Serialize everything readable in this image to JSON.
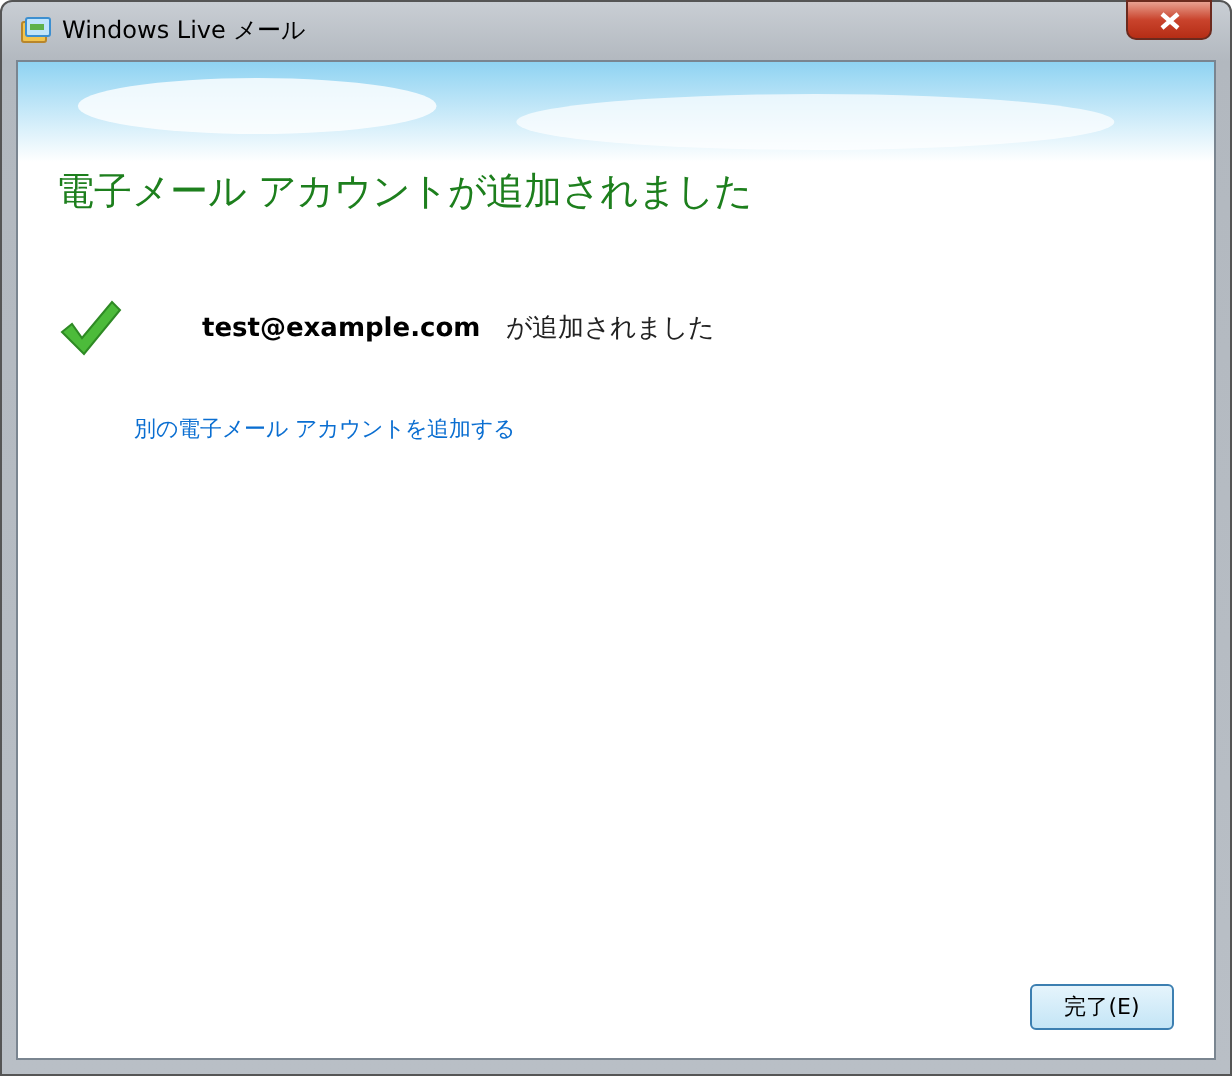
{
  "window": {
    "title": "Windows Live メール"
  },
  "heading": "電子メール アカウントが追加されました",
  "result": {
    "email": "test@example.com",
    "message": "が追加されました"
  },
  "link": "別の電子メール アカウントを追加する",
  "buttons": [
    {
      "label": "完了(E)"
    }
  ]
}
